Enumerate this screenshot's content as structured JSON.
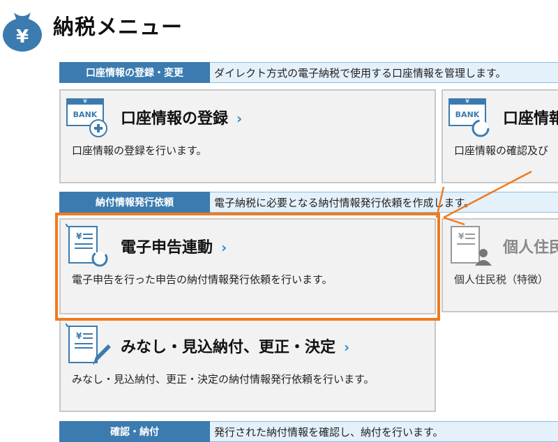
{
  "header": {
    "title": "納税メニュー",
    "icon": "yen-money-bag-icon"
  },
  "sections": [
    {
      "label": "口座情報の登録・変更",
      "desc": "ダイレクト方式の電子納税で使用する口座情報を管理します。"
    },
    {
      "label": "納付情報発行依頼",
      "desc": "電子納税に必要となる納付情報発行依頼を作成します。"
    },
    {
      "label": "確認・納付",
      "desc": "発行された納付情報を確認し、納付を行います。"
    }
  ],
  "cards": {
    "bank_register": {
      "title": "口座情報の登録",
      "desc": "口座情報の登録を行います。",
      "icon": "bank-card-add-icon"
    },
    "bank_confirm": {
      "title": "口座情報",
      "desc": "口座情報の確認及び",
      "icon": "bank-card-refresh-icon"
    },
    "e_filing": {
      "title": "電子申告連動",
      "desc": "電子申告を行った申告の納付情報発行依頼を行います。",
      "icon": "tax-document-refresh-icon"
    },
    "resident_tax": {
      "title": "個人住民",
      "desc": "個人住民税（特徴）",
      "icon": "tax-document-person-icon"
    },
    "deemed": {
      "title": "みなし・見込納付、更正・決定",
      "desc": "みなし・見込納付、更正・決定の納付情報発行依頼を行います。",
      "icon": "tax-document-pen-icon"
    }
  },
  "chevron": "›",
  "colors": {
    "accent": "#3b7bb0",
    "highlight": "#f07a1e",
    "link": "#2f8fd0"
  }
}
